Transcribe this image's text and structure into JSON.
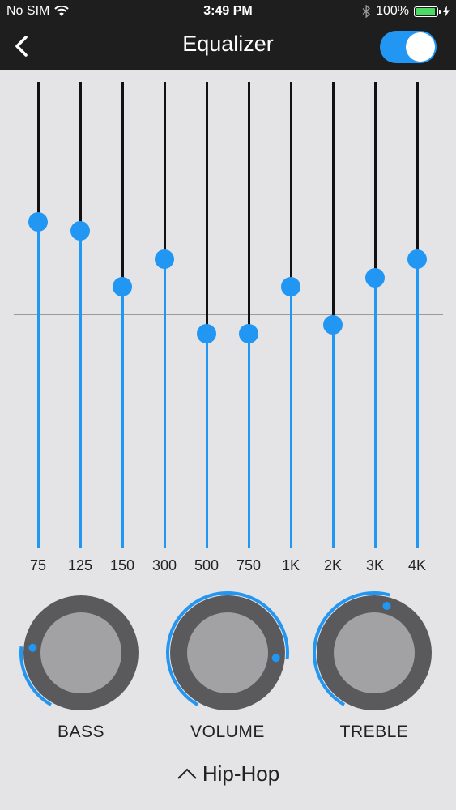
{
  "status_bar": {
    "carrier": "No SIM",
    "time": "3:49 PM",
    "battery_percent": "100%",
    "battery_level": 1.0
  },
  "header": {
    "title": "Equalizer",
    "enabled": true
  },
  "colors": {
    "accent": "#2196f3",
    "bar_background": "#1e1e1f",
    "page_background": "#e4e4e6",
    "knob_outer": "#5a5a5c",
    "knob_inner": "#a2a2a4"
  },
  "equalizer": {
    "bands": [
      {
        "label": "75",
        "level": 0.3
      },
      {
        "label": "125",
        "level": 0.32
      },
      {
        "label": "150",
        "level": 0.44
      },
      {
        "label": "300",
        "level": 0.38
      },
      {
        "label": "500",
        "level": 0.54
      },
      {
        "label": "750",
        "level": 0.54
      },
      {
        "label": "1K",
        "level": 0.44
      },
      {
        "label": "2K",
        "level": 0.52
      },
      {
        "label": "3K",
        "level": 0.42
      },
      {
        "label": "4K",
        "level": 0.38
      }
    ]
  },
  "knobs": [
    {
      "label": "BASS",
      "level": 0.22
    },
    {
      "label": "VOLUME",
      "level": 0.82
    },
    {
      "label": "TREBLE",
      "level": 0.55
    }
  ],
  "preset": {
    "label": "Hip-Hop",
    "icon": "chevron-up-icon"
  }
}
